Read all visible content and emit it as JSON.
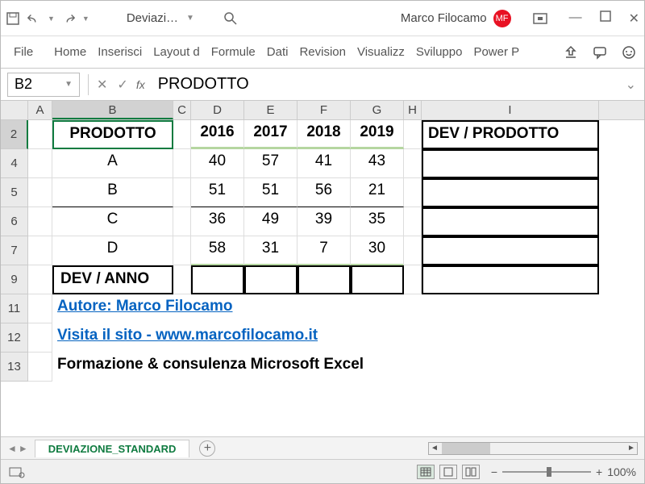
{
  "titlebar": {
    "doc_name": "Deviazi…",
    "user_name": "Marco Filocamo",
    "user_initials": "MF"
  },
  "ribbon": {
    "tabs": [
      "File",
      "Home",
      "Inserisci",
      "Layout d",
      "Formule",
      "Dati",
      "Revision",
      "Visualizz",
      "Sviluppo",
      "Power P"
    ]
  },
  "formula_bar": {
    "cell_ref": "B2",
    "fx_label": "fx",
    "content": "PRODOTTO"
  },
  "columns": [
    "A",
    "B",
    "C",
    "D",
    "E",
    "F",
    "G",
    "H",
    "I"
  ],
  "rows": [
    "2",
    "4",
    "5",
    "6",
    "7",
    "9",
    "11",
    "12",
    "13"
  ],
  "cells": {
    "B2": "PRODOTTO",
    "D2": "2016",
    "E2": "2017",
    "F2": "2018",
    "G2": "2019",
    "I2": "DEV / PRODOTTO",
    "B4": "A",
    "D4": "40",
    "E4": "57",
    "F4": "41",
    "G4": "43",
    "B5": "B",
    "D5": "51",
    "E5": "51",
    "F5": "56",
    "G5": "21",
    "B6": "C",
    "D6": "36",
    "E6": "49",
    "F6": "39",
    "G6": "35",
    "B7": "D",
    "D7": "58",
    "E7": "31",
    "F7": "7",
    "G7": "30",
    "B9": "DEV / ANNO",
    "B11": "Autore: Marco Filocamo",
    "B12": "Visita il sito - www.marcofilocamo.it",
    "B13": "Formazione & consulenza Microsoft Excel"
  },
  "sheet_tab": "DEVIAZIONE_STANDARD",
  "zoom": "100%",
  "chart_data": {
    "type": "table",
    "title": "PRODOTTO",
    "columns": [
      "PRODOTTO",
      "2016",
      "2017",
      "2018",
      "2019",
      "DEV / PRODOTTO"
    ],
    "rows": [
      {
        "PRODOTTO": "A",
        "2016": 40,
        "2017": 57,
        "2018": 41,
        "2019": 43
      },
      {
        "PRODOTTO": "B",
        "2016": 51,
        "2017": 51,
        "2018": 56,
        "2019": 21
      },
      {
        "PRODOTTO": "C",
        "2016": 36,
        "2017": 49,
        "2018": 39,
        "2019": 35
      },
      {
        "PRODOTTO": "D",
        "2016": 58,
        "2017": 31,
        "2018": 7,
        "2019": 30
      }
    ],
    "footer_row_label": "DEV / ANNO"
  }
}
